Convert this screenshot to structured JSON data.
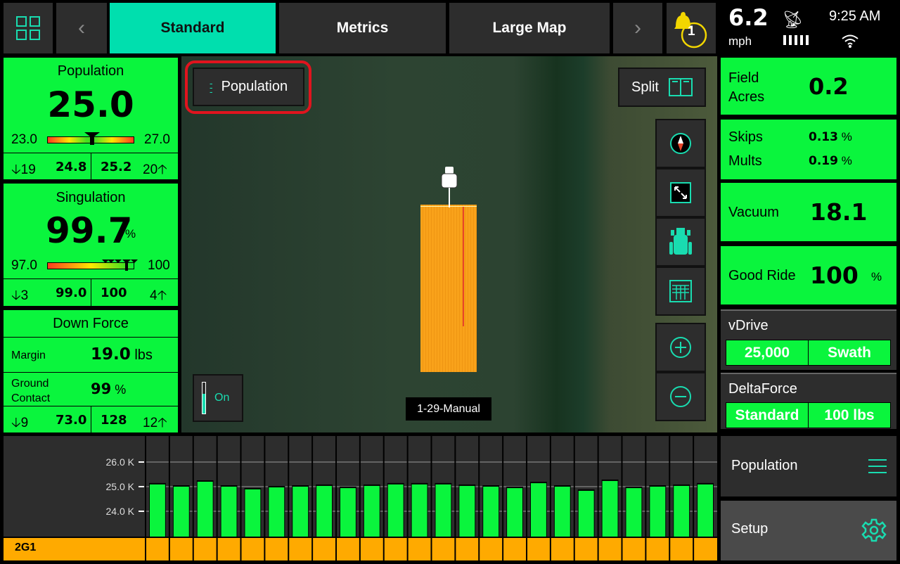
{
  "topbar": {
    "tabs": [
      {
        "label": "Standard",
        "active": true
      },
      {
        "label": "Metrics",
        "active": false
      },
      {
        "label": "Large Map",
        "active": false
      }
    ],
    "alerts_count": "1",
    "speed": "6.2",
    "speed_unit": "mph",
    "time": "9:25 AM"
  },
  "left": {
    "population": {
      "title": "Population",
      "value": "25.0",
      "min": "23.0",
      "max": "27.0",
      "low_count": "19",
      "low_value": "24.8",
      "high_value": "25.2",
      "high_count": "20"
    },
    "singulation": {
      "title": "Singulation",
      "value": "99.7",
      "unit": "%",
      "min": "97.0",
      "max": "100",
      "low_count": "3",
      "low_value": "99.0",
      "high_value": "100",
      "high_count": "4"
    },
    "downforce": {
      "title": "Down Force",
      "margin_label": "Margin",
      "margin_value": "19.0",
      "margin_unit": "lbs",
      "gc_label1": "Ground",
      "gc_label2": "Contact",
      "gc_value": "99",
      "gc_unit": "%",
      "low_count": "9",
      "low_value": "73.0",
      "high_value": "128",
      "high_count": "12"
    }
  },
  "map": {
    "layer_button": "Population",
    "split_label": "Split",
    "toggle_label": "On",
    "field_label": "1-29-Manual"
  },
  "right": {
    "field_acres_label1": "Field",
    "field_acres_label2": "Acres",
    "field_acres": "0.2",
    "skips_label": "Skips",
    "skips": "0.13",
    "mults_label": "Mults",
    "mults": "0.19",
    "pct": "%",
    "vacuum_label": "Vacuum",
    "vacuum": "18.1",
    "good_ride_label": "Good Ride",
    "good_ride": "100",
    "vdrive": {
      "title": "vDrive",
      "rate": "25,000",
      "mode": "Swath"
    },
    "deltaforce": {
      "title": "DeltaForce",
      "mode": "Standard",
      "target": "100 lbs"
    },
    "population_menu": "Population",
    "setup": "Setup"
  },
  "chart_data": {
    "type": "bar",
    "row_label": "2G1",
    "yticks": [
      "24.0 K",
      "25.0 K",
      "26.0 K"
    ],
    "ylim": [
      23.0,
      27.1
    ],
    "grid": true,
    "values": [
      25.09,
      25.0,
      25.2,
      25.0,
      24.89,
      24.97,
      25.0,
      25.03,
      24.94,
      25.03,
      25.09,
      25.09,
      25.09,
      25.03,
      25.0,
      24.94,
      25.14,
      25.0,
      24.83,
      25.23,
      24.94,
      25.0,
      25.03,
      25.09
    ],
    "bar_color": "#0af53d",
    "row_color": "#ffaa00"
  },
  "colors": {
    "accent": "#00dfae",
    "panel_green": "#0af53d",
    "alert": "#f2d600",
    "highlight": "#e0141e"
  }
}
